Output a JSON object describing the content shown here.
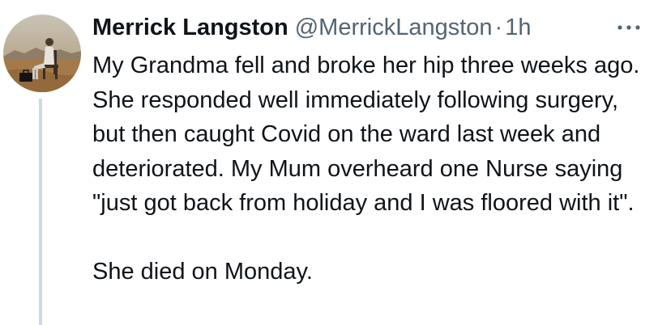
{
  "tweet": {
    "author": {
      "name": "Merrick Langston",
      "handle": "@MerrickLangston",
      "separator": "·",
      "time": "1h"
    },
    "paragraphs": [
      "My Grandma fell and broke her hip three weeks ago. She responded well immediately following surgery, but then caught Covid on the ward last week and deteriorated. My Mum overheard one Nurse saying \"just got back from holiday and I was floored with it\".",
      "She died on Monday."
    ]
  },
  "icons": {
    "avatar": "profile-photo",
    "more": "more-horizontal-icon"
  },
  "colors": {
    "text_primary": "#0f1419",
    "text_secondary": "#536471",
    "thread_line": "#cfd9de"
  }
}
